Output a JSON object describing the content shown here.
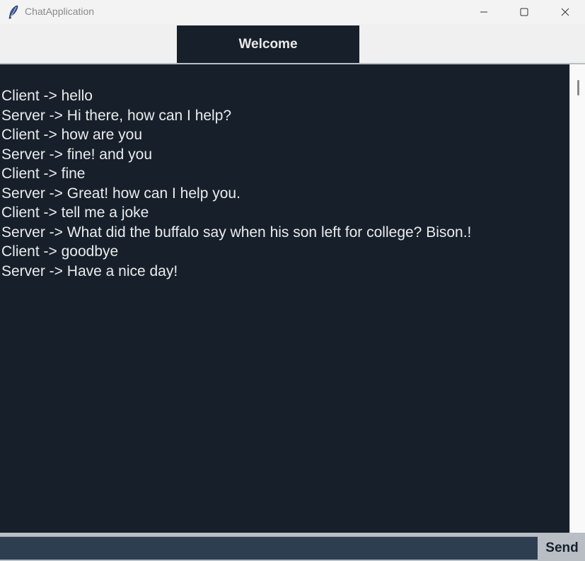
{
  "window": {
    "title": "ChatApplication",
    "app_icon": "feather-icon",
    "controls": {
      "minimize_icon": "minimize-icon",
      "maximize_icon": "maximize-icon",
      "close_icon": "close-icon"
    }
  },
  "header": {
    "label": "Welcome"
  },
  "chat": {
    "messages": [
      "Client -> hello",
      "Server -> Hi there, how can I help?",
      "Client -> how are you",
      "Server -> fine! and you",
      "Client -> fine",
      "Server -> Great! how can I help you.",
      "Client -> tell me a joke",
      "Server -> What did the buffalo say when his son left for college? Bison.!",
      "Client -> goodbye",
      "Server -> Have a nice day!"
    ]
  },
  "input": {
    "value": "",
    "placeholder": ""
  },
  "send": {
    "label": "Send"
  },
  "colors": {
    "chat_background": "#17202a",
    "chat_text": "#eaecee",
    "input_background": "#2c3e50",
    "button_background": "#b9bec5"
  }
}
